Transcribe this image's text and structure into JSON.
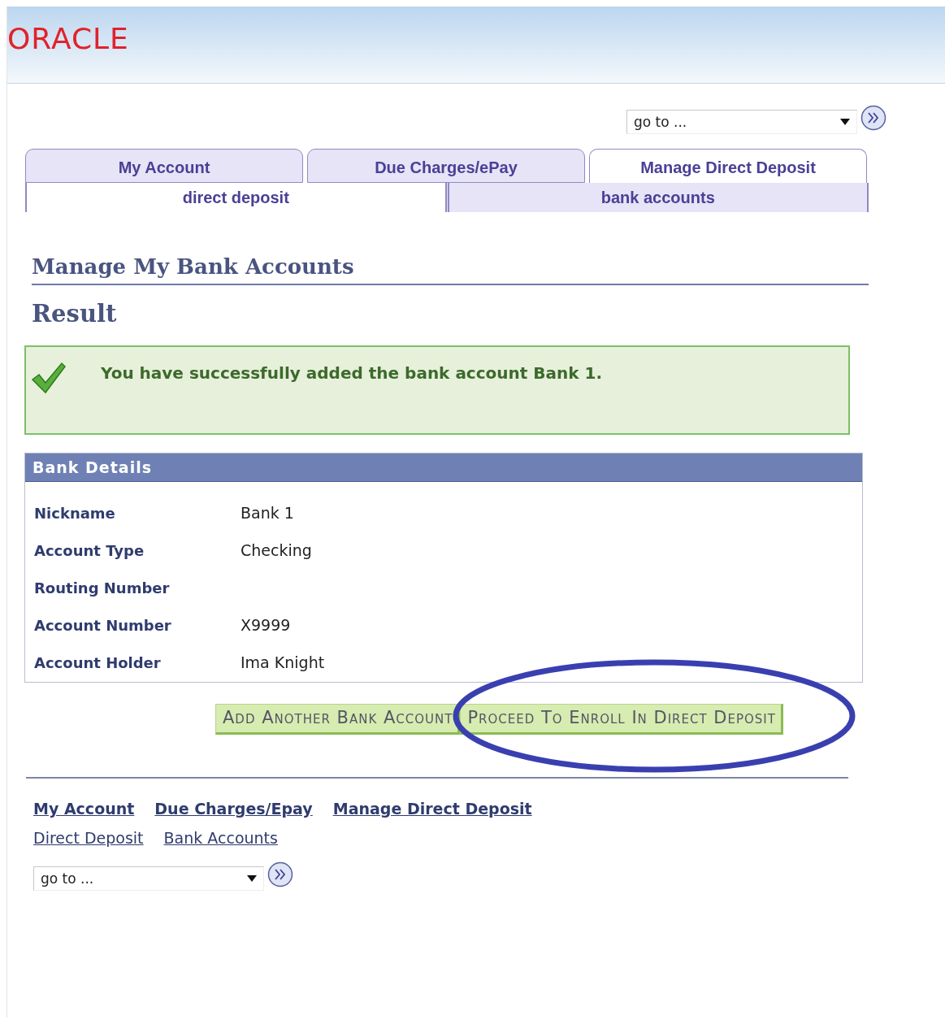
{
  "header": {
    "logo": "ORACLE"
  },
  "goto_top": {
    "value": "go to ..."
  },
  "tabs": [
    {
      "label": "My Account",
      "selected": false
    },
    {
      "label": "Due Charges/ePay",
      "selected": false
    },
    {
      "label": "Manage Direct Deposit",
      "selected": true
    }
  ],
  "subtabs": [
    {
      "label": "direct deposit",
      "selected": true
    },
    {
      "label": "bank accounts",
      "selected": false
    }
  ],
  "page_title": "Manage My Bank Accounts",
  "section_title": "Result",
  "message": {
    "text": "You have successfully added the bank account Bank 1."
  },
  "details": {
    "title": "Bank Details",
    "rows": [
      {
        "label": "Nickname",
        "value": "Bank 1"
      },
      {
        "label": "Account Type",
        "value": "Checking"
      },
      {
        "label": "Routing Number"
      },
      {
        "label": "Account Number",
        "value": "X9999"
      },
      {
        "label": "Account Holder",
        "value": "Ima Knight"
      }
    ]
  },
  "buttons": [
    {
      "label": "Add Another Bank Account",
      "circled": false
    },
    {
      "label": "Proceed To Enroll In Direct Deposit",
      "circled": true
    }
  ],
  "footer_links": [
    [
      "My Account",
      "Due Charges/Epay",
      "Manage Direct Deposit"
    ],
    [
      "Direct Deposit",
      "Bank Accounts"
    ]
  ],
  "goto_bottom": {
    "value": "go to ..."
  }
}
